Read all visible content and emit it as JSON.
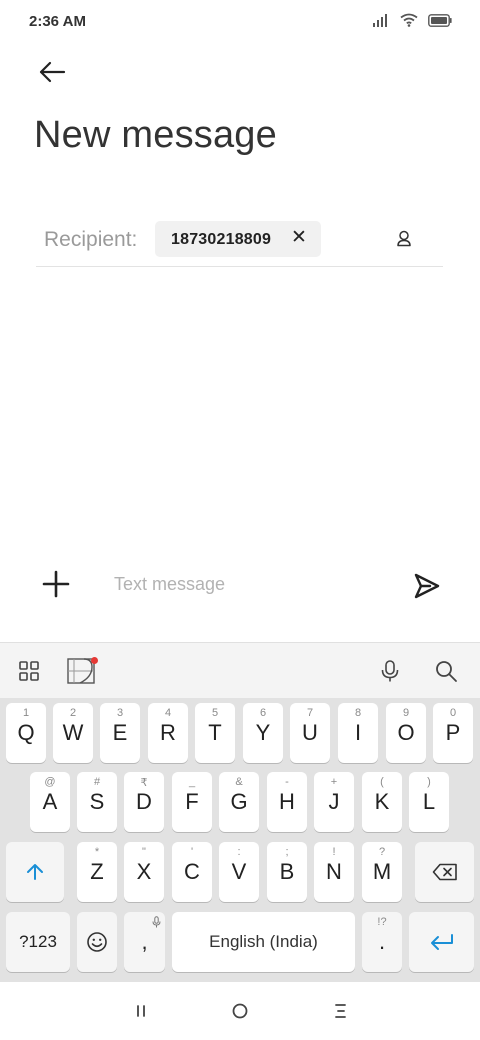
{
  "status_bar": {
    "time": "2:36 AM"
  },
  "header": {
    "title": "New message"
  },
  "recipient": {
    "label": "Recipient:",
    "chip_number": "18730218809",
    "chip_remove": "✕"
  },
  "compose": {
    "placeholder": "Text message"
  },
  "keyboard": {
    "row1": [
      {
        "hint": "1",
        "key": "Q"
      },
      {
        "hint": "2",
        "key": "W"
      },
      {
        "hint": "3",
        "key": "E"
      },
      {
        "hint": "4",
        "key": "R"
      },
      {
        "hint": "5",
        "key": "T"
      },
      {
        "hint": "6",
        "key": "Y"
      },
      {
        "hint": "7",
        "key": "U"
      },
      {
        "hint": "8",
        "key": "I"
      },
      {
        "hint": "9",
        "key": "O"
      },
      {
        "hint": "0",
        "key": "P"
      }
    ],
    "row2": [
      {
        "hint": "@",
        "key": "A"
      },
      {
        "hint": "#",
        "key": "S"
      },
      {
        "hint": "₹",
        "key": "D"
      },
      {
        "hint": "_",
        "key": "F"
      },
      {
        "hint": "&",
        "key": "G"
      },
      {
        "hint": "-",
        "key": "H"
      },
      {
        "hint": "+",
        "key": "J"
      },
      {
        "hint": "(",
        "key": "K"
      },
      {
        "hint": ")",
        "key": "L"
      }
    ],
    "row3": [
      {
        "hint": "*",
        "key": "Z"
      },
      {
        "hint": "\"",
        "key": "X"
      },
      {
        "hint": "'",
        "key": "C"
      },
      {
        "hint": ":",
        "key": "V"
      },
      {
        "hint": ";",
        "key": "B"
      },
      {
        "hint": "!",
        "key": "N"
      },
      {
        "hint": "?",
        "key": "M"
      }
    ],
    "symbols_key": "?123",
    "comma_key": ",",
    "space_label": "English (India)",
    "period_hint": "!?",
    "period_key": "."
  },
  "colors": {
    "accent": "#1a8fd6",
    "notification_dot": "#e53935"
  }
}
